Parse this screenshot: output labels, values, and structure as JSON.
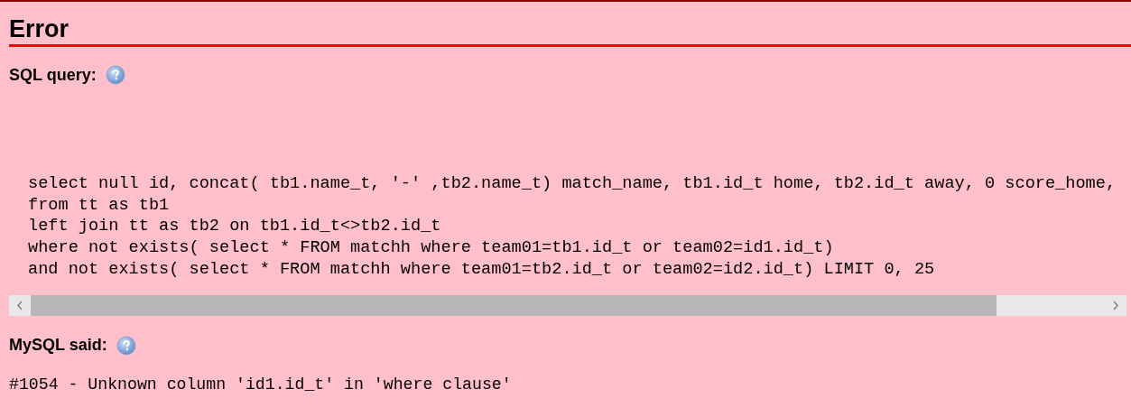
{
  "title": "Error",
  "sql_query": {
    "label": "SQL query:",
    "lines": [
      "select null id, concat( tb1.name_t, '-' ,tb2.name_t) match_name, tb1.id_t home, tb2.id_t away, 0 score_home,",
      "from tt as tb1",
      "left join tt as tb2 on tb1.id_t<>tb2.id_t",
      "where not exists( select * FROM matchh where team01=tb1.id_t or team02=id1.id_t)",
      "and not exists( select * FROM matchh where team01=tb2.id_t or team02=id2.id_t) LIMIT 0, 25"
    ]
  },
  "mysql_said": {
    "label": "MySQL said:",
    "message": "#1054 - Unknown column 'id1.id_t' in 'where clause'"
  }
}
